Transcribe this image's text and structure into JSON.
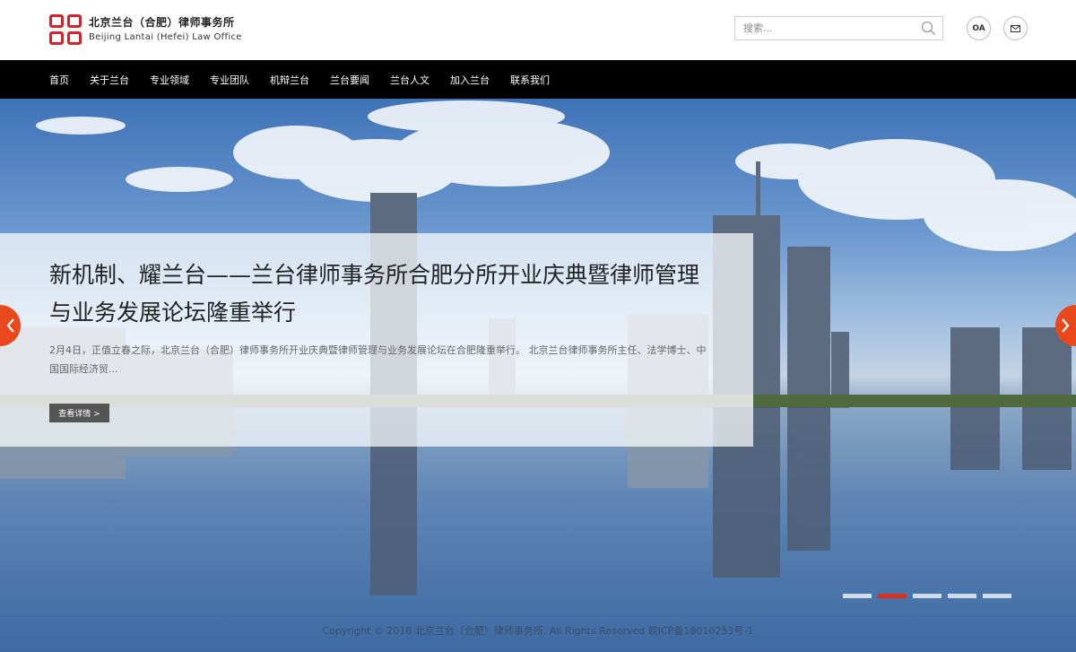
{
  "brand": {
    "name_cn": "北京兰台（合肥）律师事务所",
    "name_en": "Beijing Lantai (Hefei) Law Office",
    "accent_color": "#d8222a"
  },
  "header": {
    "search_placeholder": "搜索...",
    "oa_label": "OA",
    "mail_icon": "mail-icon"
  },
  "nav": {
    "items": [
      "首页",
      "关于兰台",
      "专业领域",
      "专业团队",
      "机辩兰台",
      "兰台要闻",
      "兰台人文",
      "加入兰台",
      "联系我们"
    ]
  },
  "slider": {
    "title": "新机制、耀兰台——兰台律师事务所合肥分所开业庆典暨律师管理与业务发展论坛隆重举行",
    "summary": "2月4日，正值立春之际，北京兰台（合肥）律师事务所开业庆典暨律师管理与业务发展论坛在合肥隆重举行。 北京兰台律师事务所主任、法学博士、中国国际经济贸...",
    "more_label": "查看详情 >",
    "slide_count": 5,
    "active_slide": 2,
    "arrow_color": "#e8481c"
  },
  "footer": {
    "copyright": "Copyright © 2018 北京兰台（合肥）律师事务所. All Rights Reserved 皖ICP备18010253号-1"
  }
}
